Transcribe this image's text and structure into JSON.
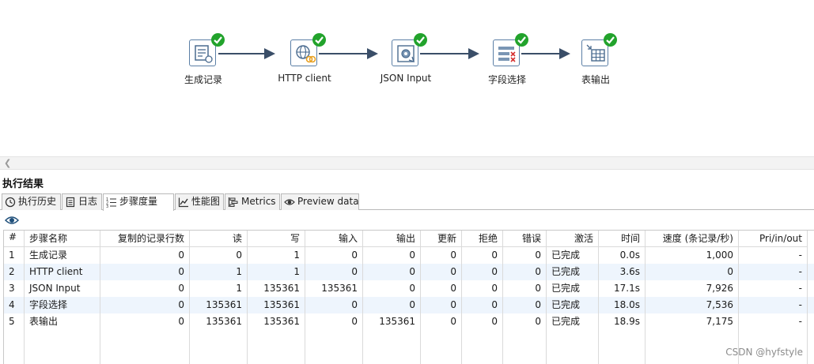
{
  "flow": {
    "steps": [
      {
        "label": "生成记录",
        "icon": "generate-rows-icon"
      },
      {
        "label": "HTTP client",
        "icon": "http-client-icon"
      },
      {
        "label": "JSON Input",
        "icon": "json-input-icon"
      },
      {
        "label": "字段选择",
        "icon": "select-values-icon"
      },
      {
        "label": "表输出",
        "icon": "table-output-icon"
      }
    ],
    "status_icon": "success-check-icon"
  },
  "panel": {
    "title": "执行结果",
    "tabs": [
      {
        "label": "执行历史",
        "icon": "history-icon"
      },
      {
        "label": "日志",
        "icon": "log-icon"
      },
      {
        "label": "步骤度量",
        "icon": "step-metrics-icon",
        "active": true
      },
      {
        "label": "性能图",
        "icon": "performance-chart-icon"
      },
      {
        "label": "Metrics",
        "icon": "metrics-icon"
      },
      {
        "label": "Preview data",
        "icon": "preview-eye-icon"
      }
    ]
  },
  "table": {
    "headers": [
      "#",
      "步骤名称",
      "复制的记录行数",
      "读",
      "写",
      "输入",
      "输出",
      "更新",
      "拒绝",
      "错误",
      "激活",
      "时间",
      "速度 (条记录/秒)",
      "Pri/in/out"
    ],
    "rows": [
      [
        "1",
        "生成记录",
        "0",
        "0",
        "1",
        "0",
        "0",
        "0",
        "0",
        "0",
        "已完成",
        "0.0s",
        "1,000",
        "-"
      ],
      [
        "2",
        "HTTP client",
        "0",
        "1",
        "1",
        "0",
        "0",
        "0",
        "0",
        "0",
        "已完成",
        "3.6s",
        "0",
        "-"
      ],
      [
        "3",
        "JSON Input",
        "0",
        "1",
        "135361",
        "135361",
        "0",
        "0",
        "0",
        "0",
        "已完成",
        "17.1s",
        "7,926",
        "-"
      ],
      [
        "4",
        "字段选择",
        "0",
        "135361",
        "135361",
        "0",
        "0",
        "0",
        "0",
        "0",
        "已完成",
        "18.0s",
        "7,536",
        "-"
      ],
      [
        "5",
        "表输出",
        "0",
        "135361",
        "135361",
        "0",
        "135361",
        "0",
        "0",
        "0",
        "已完成",
        "18.9s",
        "7,175",
        "-"
      ]
    ]
  },
  "watermark": "CSDN @hyfstyle",
  "colors": {
    "success": "#22a32c",
    "hop": "#3a4e68",
    "alt_row": "#eef5fd"
  }
}
